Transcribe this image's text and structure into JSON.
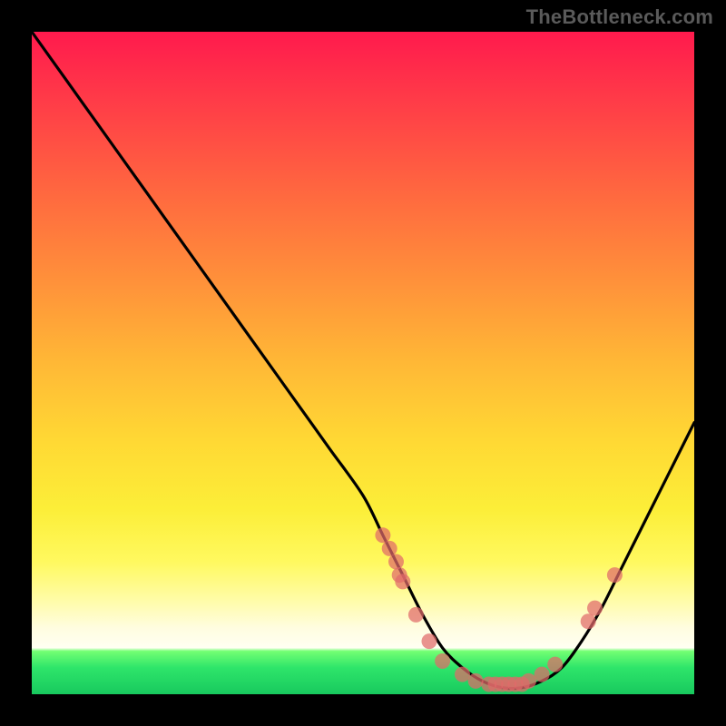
{
  "watermark": "TheBottleneck.com",
  "colors": {
    "dot": "#e06a6a",
    "curve": "#000000",
    "frame": "#000000"
  },
  "chart_data": {
    "type": "line",
    "title": "",
    "xlabel": "",
    "ylabel": "",
    "xlim": [
      0,
      100
    ],
    "ylim": [
      0,
      100
    ],
    "series": [
      {
        "name": "bottleneck-curve",
        "x": [
          0,
          5,
          10,
          15,
          20,
          25,
          30,
          35,
          40,
          45,
          50,
          53,
          56,
          59,
          62,
          65,
          68,
          71,
          74,
          77,
          80,
          83,
          86,
          89,
          92,
          95,
          98,
          100
        ],
        "y": [
          100,
          93,
          86,
          79,
          72,
          65,
          58,
          51,
          44,
          37,
          30,
          24,
          18,
          12,
          7,
          4,
          2,
          1,
          1,
          2,
          4,
          8,
          13,
          19,
          25,
          31,
          37,
          41
        ]
      }
    ],
    "points": [
      {
        "x": 53,
        "y": 24
      },
      {
        "x": 54,
        "y": 22
      },
      {
        "x": 55,
        "y": 20
      },
      {
        "x": 55.5,
        "y": 18
      },
      {
        "x": 56,
        "y": 17
      },
      {
        "x": 58,
        "y": 12
      },
      {
        "x": 60,
        "y": 8
      },
      {
        "x": 62,
        "y": 5
      },
      {
        "x": 65,
        "y": 3
      },
      {
        "x": 67,
        "y": 2
      },
      {
        "x": 69,
        "y": 1.5
      },
      {
        "x": 70,
        "y": 1.5
      },
      {
        "x": 71,
        "y": 1.5
      },
      {
        "x": 72,
        "y": 1.5
      },
      {
        "x": 73,
        "y": 1.5
      },
      {
        "x": 74,
        "y": 1.5
      },
      {
        "x": 75,
        "y": 2
      },
      {
        "x": 77,
        "y": 3
      },
      {
        "x": 79,
        "y": 4.5
      },
      {
        "x": 84,
        "y": 11
      },
      {
        "x": 85,
        "y": 13
      },
      {
        "x": 88,
        "y": 18
      }
    ]
  }
}
